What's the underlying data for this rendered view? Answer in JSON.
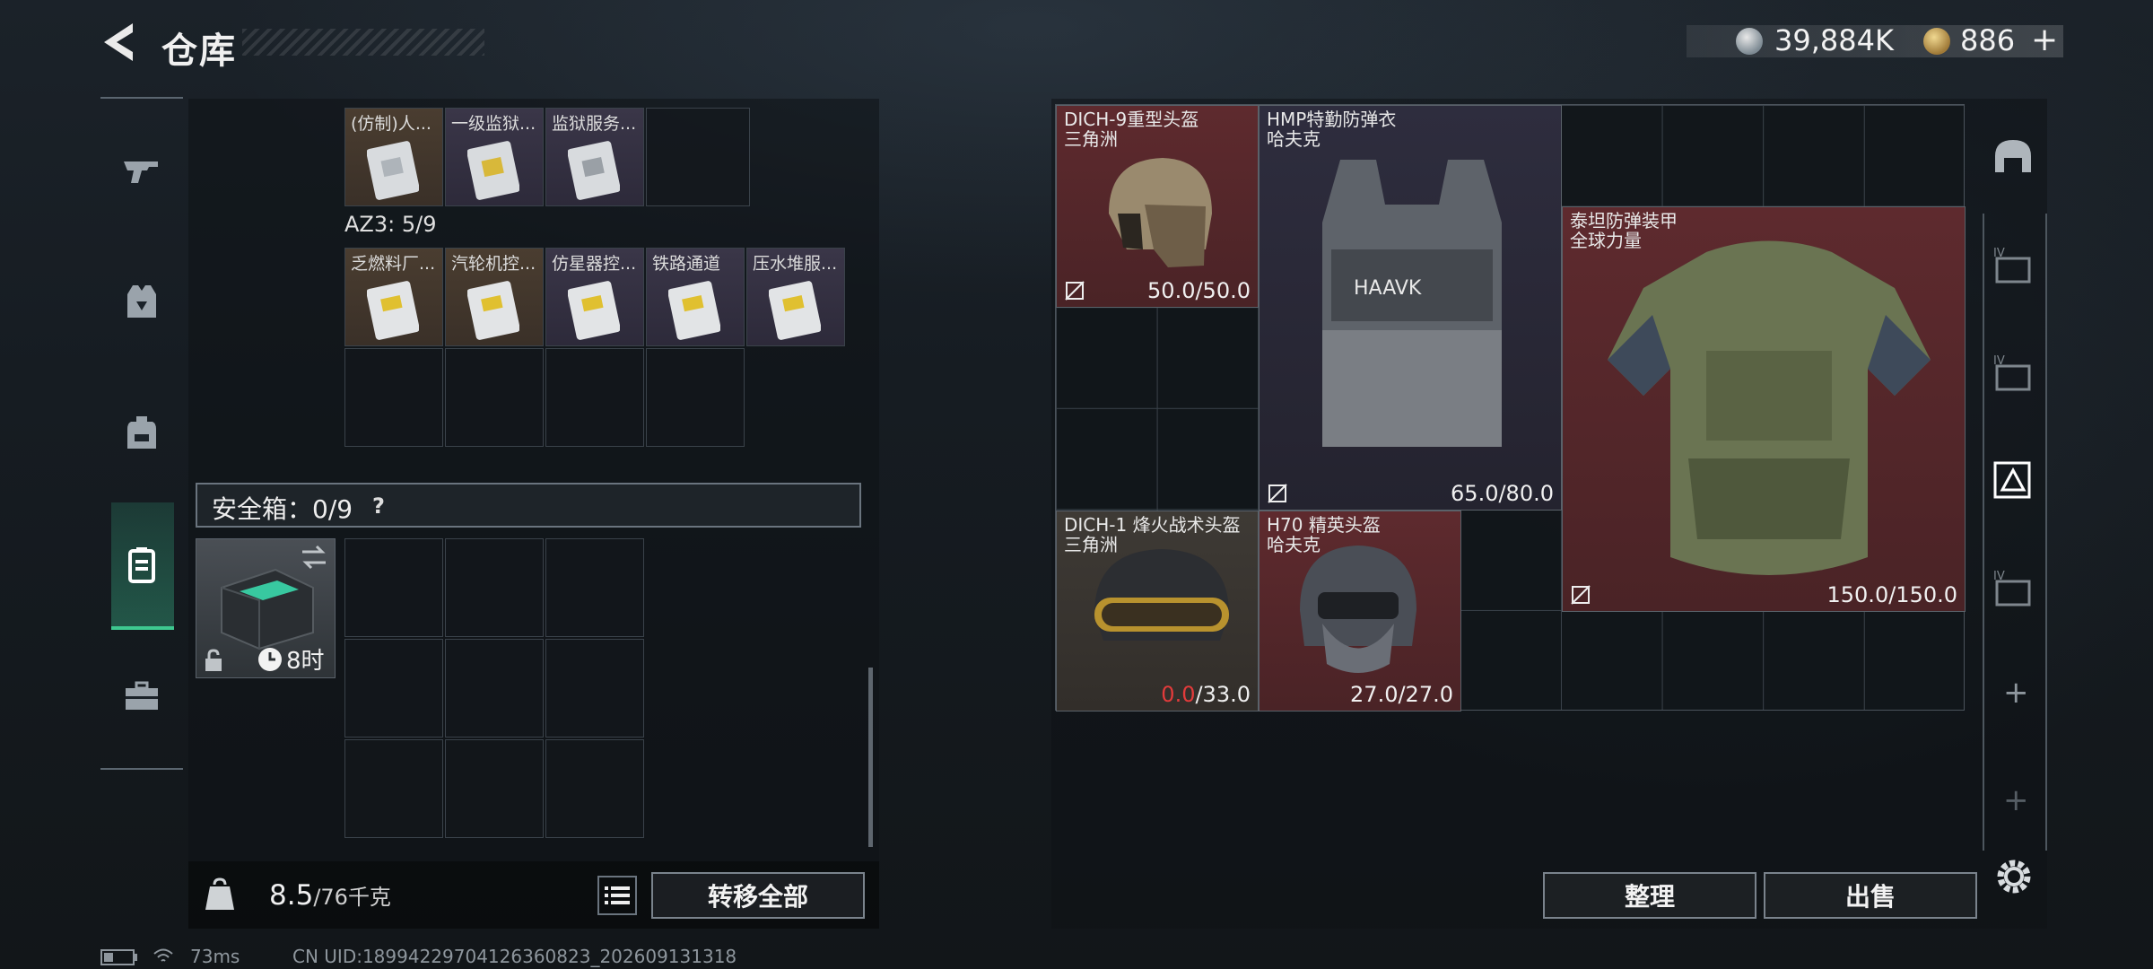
{
  "header": {
    "title": "仓库",
    "currency1": "39,884K",
    "currency2": "886",
    "currency2_plus": "+"
  },
  "nav": {
    "items": [
      "gun-icon",
      "armor-vest-icon",
      "backpack-icon",
      "safebox-icon",
      "briefcase-icon"
    ],
    "active": "safebox-icon"
  },
  "left_panel": {
    "row1": [
      "(仿制)人...",
      "一级监狱...",
      "监狱服务..."
    ],
    "az3_label": "AZ3: 5/9",
    "row2": [
      "乏燃料厂...",
      "汽轮机控...",
      "仿星器控...",
      "铁路通道",
      "压水堆服..."
    ],
    "safe_box_label": "安全箱：0/9",
    "safe_box_help": "?",
    "safe_box_timer": "8时",
    "weight_current": "8.5",
    "weight_max": "/76千克",
    "transfer_all": "转移全部"
  },
  "right_panel": {
    "items": [
      {
        "name": "DICH-9重型头盔",
        "sub": "三角洲",
        "durability": "50.0/50.0"
      },
      {
        "name": "HMP特勤防弹衣",
        "sub": "哈夫克",
        "durability": "65.0/80.0"
      },
      {
        "name": "泰坦防弹装甲",
        "sub": "全球力量",
        "durability": "150.0/150.0"
      },
      {
        "name": "DICH-1 烽火战术头盔",
        "sub": "三角洲",
        "durability_current": "0.0",
        "durability_max": "/33.0"
      },
      {
        "name": "H70 精英头盔",
        "sub": "哈夫克",
        "durability": "27.0/27.0"
      }
    ],
    "vest_logo_text": "HAAVK",
    "sort_button": "整理",
    "sell_button": "出售"
  },
  "right_slots": {
    "slot_label": "IV",
    "plus": "+"
  },
  "status": {
    "ping": "73ms",
    "uid": "CN UID:18994229704126360823_202609131318"
  }
}
